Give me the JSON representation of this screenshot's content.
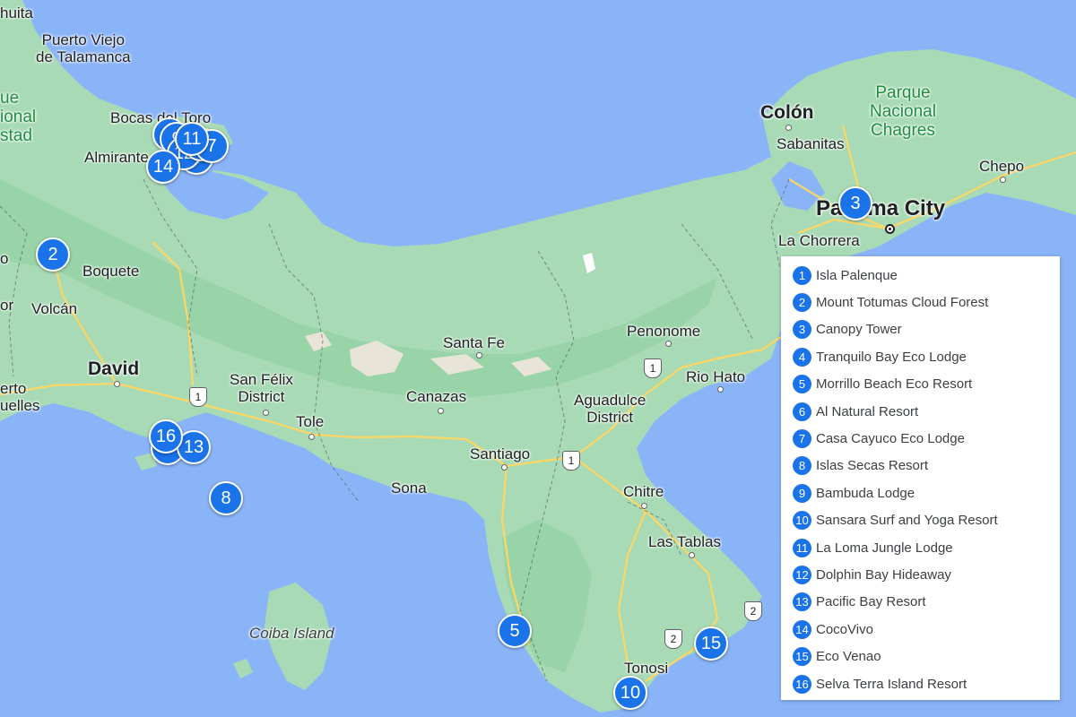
{
  "labels": {
    "huita": "huita",
    "puerto_viejo": "Puerto Viejo\nde Talamanca",
    "park_west": "ue\nional\nstad",
    "bocas": "Bocas del Toro",
    "almirante": "Almirante",
    "boquete": "Boquete",
    "volcan": "Volcán",
    "david": "David",
    "puerto_armuelles": "erto\nuelles",
    "or": "or",
    "o_edge": "o",
    "san_felix": "San Félix\nDistrict",
    "tole": "Tole",
    "canazas": "Canazas",
    "santa_fe": "Santa Fe",
    "santiago": "Santiago",
    "sona": "Sona",
    "penonome": "Penonome",
    "aguadulce": "Aguadulce\nDistrict",
    "rio_hato": "Rio Hato",
    "chitre": "Chitre",
    "las_tablas": "Las Tablas",
    "tonosi": "Tonosi",
    "coiba": "Coiba Island",
    "colon": "Colón",
    "sabanitas": "Sabanitas",
    "chagres": "Parque\nNacional\nChagres",
    "chepo": "Chepo",
    "panama_city": "Panama City",
    "la_chorrera": "La Chorrera"
  },
  "route_shields": [
    "1",
    "1",
    "1",
    "2",
    "2"
  ],
  "markers": [
    {
      "label": "2"
    },
    {
      "label": "3"
    },
    {
      "label": "5"
    },
    {
      "label": "8"
    },
    {
      "label": "10"
    },
    {
      "label": "15"
    },
    {
      "label": "16"
    },
    {
      "label": "13"
    },
    {
      "label": "1"
    },
    {
      "label": "9"
    },
    {
      "label": "4"
    },
    {
      "label": "12"
    },
    {
      "label": "6"
    },
    {
      "label": "7"
    },
    {
      "label": "11"
    },
    {
      "label": "14"
    }
  ],
  "legend": [
    {
      "num": "1",
      "name": "Isla Palenque"
    },
    {
      "num": "2",
      "name": "Mount Totumas Cloud Forest"
    },
    {
      "num": "3",
      "name": "Canopy Tower"
    },
    {
      "num": "4",
      "name": "Tranquilo Bay Eco Lodge"
    },
    {
      "num": "5",
      "name": "Morrillo Beach Eco Resort"
    },
    {
      "num": "6",
      "name": "Al Natural Resort"
    },
    {
      "num": "7",
      "name": "Casa Cayuco Eco Lodge"
    },
    {
      "num": "8",
      "name": "Islas Secas Resort"
    },
    {
      "num": "9",
      "name": "Bambuda Lodge"
    },
    {
      "num": "10",
      "name": "Sansara Surf and Yoga Resort"
    },
    {
      "num": "11",
      "name": "La Loma Jungle Lodge"
    },
    {
      "num": "12",
      "name": "Dolphin Bay Hideaway"
    },
    {
      "num": "13",
      "name": "Pacific Bay Resort"
    },
    {
      "num": "14",
      "name": "CocoVivo"
    },
    {
      "num": "15",
      "name": "Eco Venao"
    },
    {
      "num": "16",
      "name": "Selva Terra Island Resort"
    }
  ],
  "colors": {
    "water": "#8ab4f8",
    "land": "#a8dab5",
    "land_dark": "#94d2a5",
    "marker": "#1a73e8",
    "road": "#fdd663"
  }
}
